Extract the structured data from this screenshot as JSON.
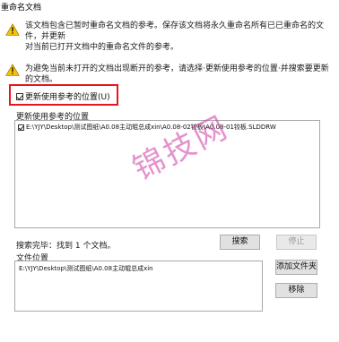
{
  "window": {
    "title": "重命名文档"
  },
  "warning1": {
    "line1": "该文档包含已暂时重命名文档的参考。保存该文档将永久重命名所有已已重命名的文件，并更新",
    "line2": "对当前已打开文档中的重命名文件的参考。"
  },
  "warning2": {
    "text": "为避免当前未打开的文档出现断开的参考，请选择·更新使用参考的位置·并搜索要更新的文档。"
  },
  "update_checkbox": {
    "label": "更新使用参考的位置(U)",
    "checked": true
  },
  "refs_section": {
    "label": "更新使用参考的位置",
    "items": [
      {
        "checked": true,
        "path": "E:\\YJY\\Desktop\\测试图纸\\A0.08主动辊总成xin\\A0.08-02铰板\\A0.08-01铰板.SLDDRW"
      }
    ]
  },
  "search": {
    "status": "搜索完毕：找到 1 个文档。",
    "search_button": "搜索",
    "stop_button": "停止"
  },
  "file_locations": {
    "label": "文件位置",
    "items": [
      "E:\\YJY\\Desktop\\测试图纸\\A0.08主动辊总成xin"
    ],
    "add_folder_button": "添加文件夹",
    "remove_button": "移除"
  },
  "watermark": {
    "text": "锦技网"
  },
  "colors": {
    "highlight_border": "#e8161c",
    "warning_yellow": "#f4c20d",
    "watermark": "#ce3aa3"
  },
  "icons": {
    "warning": "warning-triangle-icon",
    "checkbox": "checkmark-icon"
  }
}
